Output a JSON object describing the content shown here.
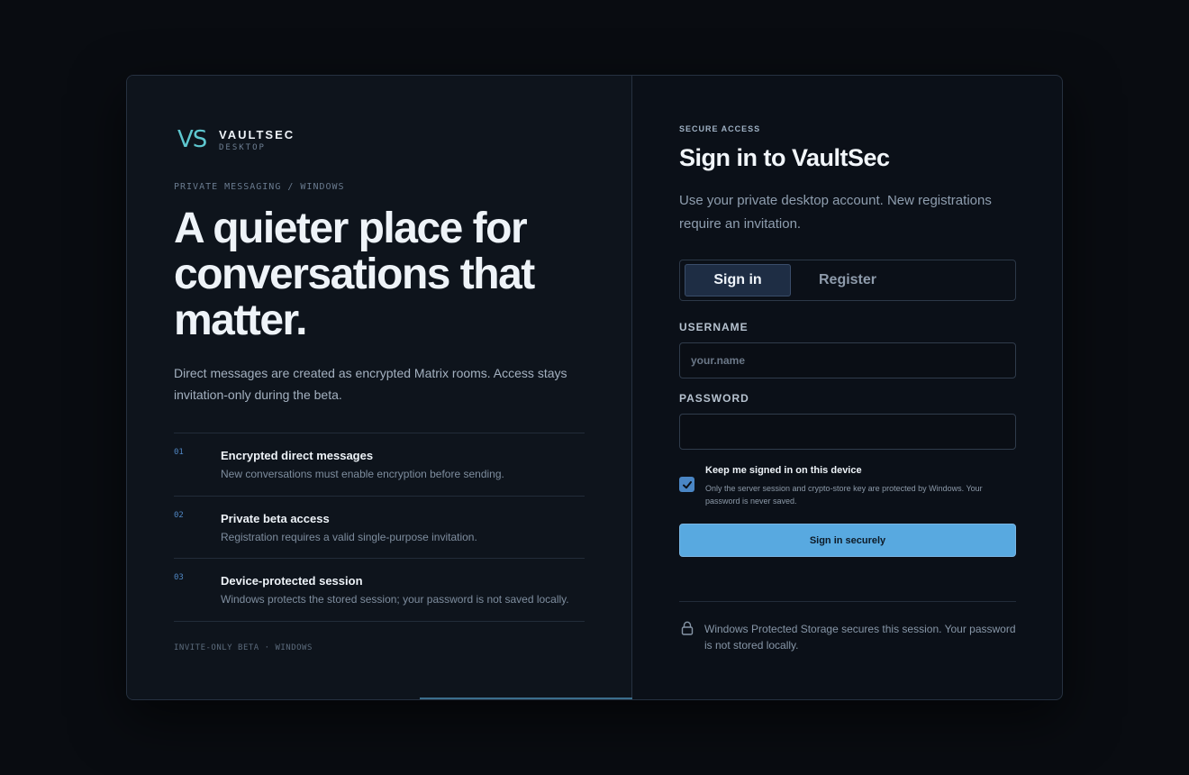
{
  "brand": {
    "mark": "VS",
    "name": "VAULTSEC",
    "sub": "DESKTOP"
  },
  "hero": {
    "kicker": "PRIVATE MESSAGING / WINDOWS",
    "headline": "A quieter place for conversations that matter.",
    "lede": "Direct messages are created as encrypted Matrix rooms. Access stays invitation-only during the beta."
  },
  "features": [
    {
      "num": "01",
      "title": "Encrypted direct messages",
      "desc": "New conversations must enable encryption before sending."
    },
    {
      "num": "02",
      "title": "Private beta access",
      "desc": "Registration requires a valid single-purpose invitation."
    },
    {
      "num": "03",
      "title": "Device-protected session",
      "desc": "Windows protects the stored session; your password is not saved locally."
    }
  ],
  "footnote": "INVITE-ONLY BETA · WINDOWS",
  "auth": {
    "kicker": "SECURE ACCESS",
    "title": "Sign in to VaultSec",
    "lede": "Use your private desktop account. New registrations require an invitation.",
    "tabs": {
      "signin": "Sign in",
      "register": "Register"
    },
    "username": {
      "label": "USERNAME",
      "value": "",
      "placeholder": "your.name"
    },
    "password": {
      "label": "PASSWORD",
      "value": "",
      "placeholder": ""
    },
    "remember": {
      "checked": true,
      "title": "Keep me signed in on this device",
      "desc": "Only the server session and crypto-store key are protected by Windows. Your password is never saved."
    },
    "submit": "Sign in securely",
    "note": "Windows Protected Storage secures this session. Your password is not stored locally."
  },
  "colors": {
    "accent": "#58a9e0",
    "brand": "#5ec7cf",
    "background": "#090c11"
  },
  "icons": {
    "lock": "lock-icon",
    "check": "checkmark-icon"
  }
}
